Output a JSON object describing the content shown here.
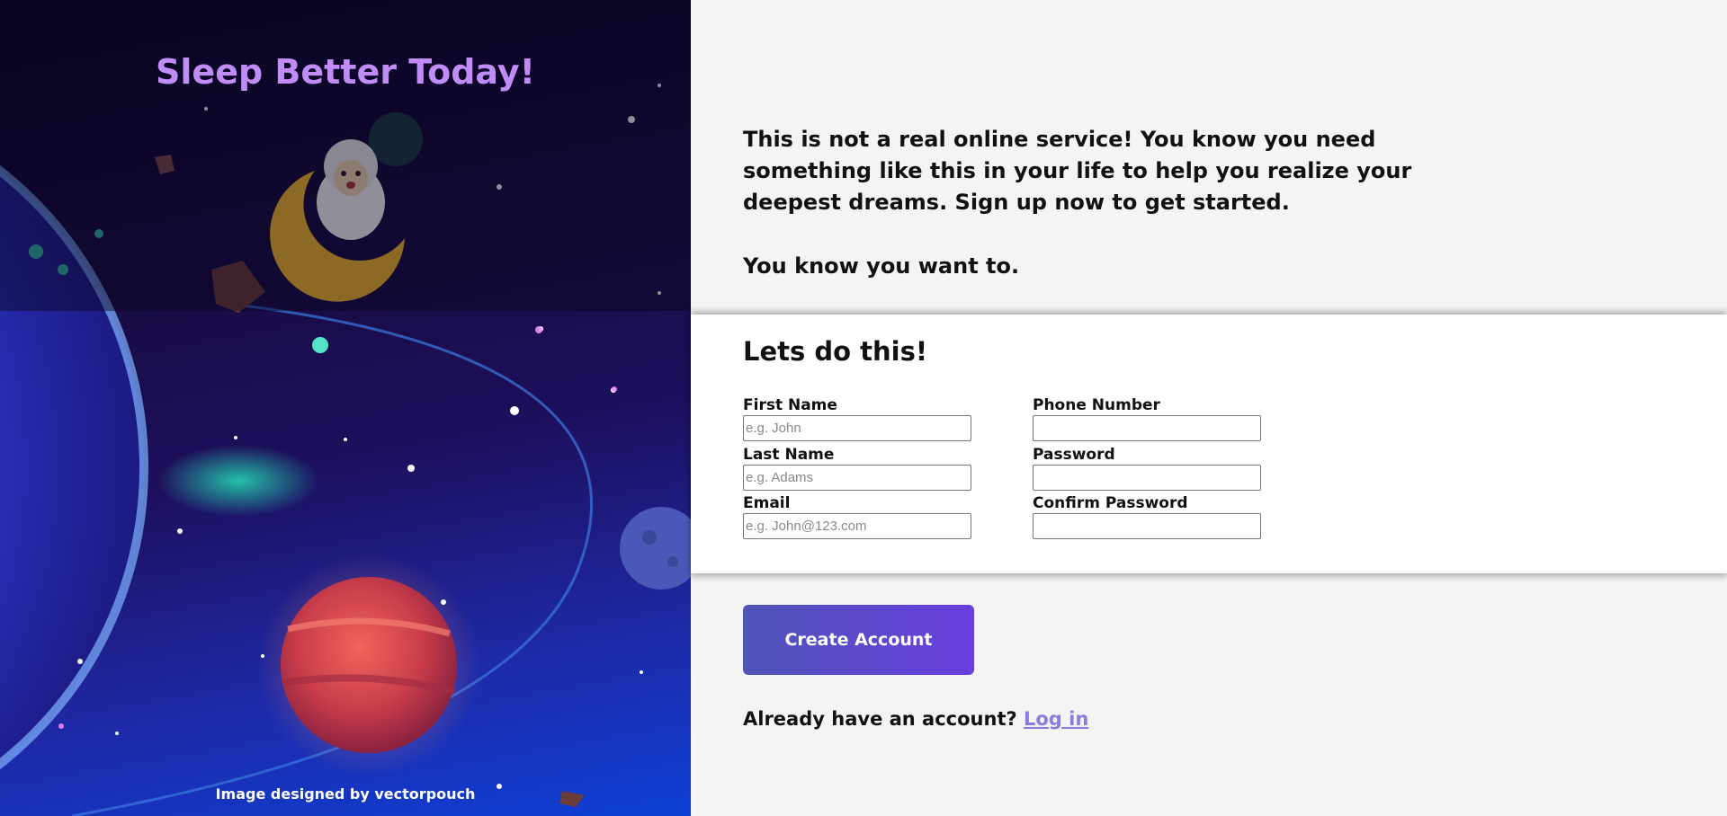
{
  "hero": {
    "title": "Sleep Better Today!",
    "credit": "Image designed by vectorpouch"
  },
  "intro": {
    "paragraph1": "This is not a real online service! You know you need something like this in your life to help you realize your deepest dreams. Sign up now to get started.",
    "paragraph2": "You know you want to."
  },
  "form": {
    "title": "Lets do this!",
    "fields": {
      "first_name": {
        "label": "First Name",
        "placeholder": "e.g. John",
        "value": ""
      },
      "last_name": {
        "label": "Last Name",
        "placeholder": "e.g. Adams",
        "value": ""
      },
      "email": {
        "label": "Email",
        "placeholder": "e.g. John@123.com",
        "value": ""
      },
      "phone": {
        "label": "Phone Number",
        "placeholder": "",
        "value": ""
      },
      "password": {
        "label": "Password",
        "placeholder": "",
        "value": ""
      },
      "confirm_password": {
        "label": "Confirm Password",
        "placeholder": "",
        "value": ""
      }
    }
  },
  "actions": {
    "create_account": "Create Account",
    "login_prompt": "Already have an account?",
    "login_link": "Log in"
  },
  "colors": {
    "title_accent": "#c08cf5",
    "button_start": "#4f54b6",
    "button_end": "#6a3fe0",
    "link": "#8b7de0"
  },
  "icons": [
    "sheep-on-moon-illustration",
    "planet-illustration"
  ]
}
